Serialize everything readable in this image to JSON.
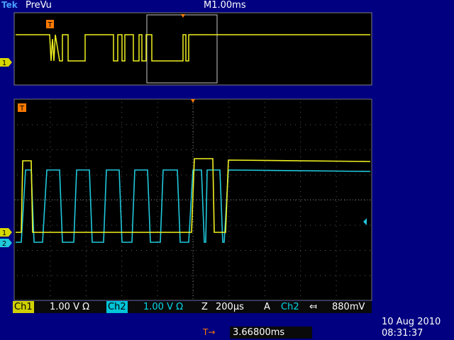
{
  "header": {
    "brand": "Tek",
    "mode": "PreVu",
    "timebase": "M1.00ms"
  },
  "markers": {
    "trigger_symbol": "T",
    "ch1_symbol": "1",
    "ch2_symbol": "2"
  },
  "status": {
    "ch1_label": "Ch1",
    "ch1_scale": "1.00 V Ω",
    "ch2_label": "Ch2",
    "ch2_scale": "1.00 V Ω",
    "zoom_label": "Z",
    "zoom_scale": "200µs",
    "trigger_mode": "A",
    "trigger_source": "Ch2",
    "trigger_slope": "⤆",
    "trigger_level": "880mV"
  },
  "trigger_position": {
    "icon": "T→",
    "value": "3.66800ms"
  },
  "datetime": {
    "date": "10 Aug 2010",
    "time": "08:31:37"
  },
  "colors": {
    "background": "#000080",
    "ch1": "#f0f020",
    "ch2": "#20c8dc",
    "trigger": "#ff7a00",
    "grid": "#0a0a0a"
  }
}
